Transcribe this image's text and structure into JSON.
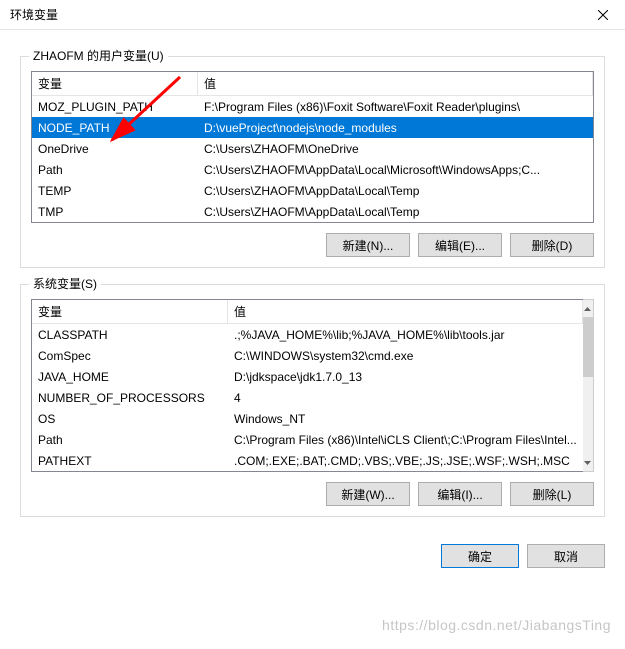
{
  "window": {
    "title": "环境变量"
  },
  "user_vars": {
    "legend": "ZHAOFM 的用户变量(U)",
    "header": {
      "name": "变量",
      "value": "值"
    },
    "rows": [
      {
        "name": "MOZ_PLUGIN_PATH",
        "value": "F:\\Program Files (x86)\\Foxit Software\\Foxit Reader\\plugins\\",
        "selected": false
      },
      {
        "name": "NODE_PATH",
        "value": "D:\\vueProject\\nodejs\\node_modules",
        "selected": true
      },
      {
        "name": "OneDrive",
        "value": "C:\\Users\\ZHAOFM\\OneDrive",
        "selected": false
      },
      {
        "name": "Path",
        "value": "C:\\Users\\ZHAOFM\\AppData\\Local\\Microsoft\\WindowsApps;C...",
        "selected": false
      },
      {
        "name": "TEMP",
        "value": "C:\\Users\\ZHAOFM\\AppData\\Local\\Temp",
        "selected": false
      },
      {
        "name": "TMP",
        "value": "C:\\Users\\ZHAOFM\\AppData\\Local\\Temp",
        "selected": false
      }
    ],
    "buttons": {
      "new": "新建(N)...",
      "edit": "编辑(E)...",
      "delete": "删除(D)"
    }
  },
  "sys_vars": {
    "legend": "系统变量(S)",
    "header": {
      "name": "变量",
      "value": "值"
    },
    "rows": [
      {
        "name": "CLASSPATH",
        "value": ".;%JAVA_HOME%\\lib;%JAVA_HOME%\\lib\\tools.jar"
      },
      {
        "name": "ComSpec",
        "value": "C:\\WINDOWS\\system32\\cmd.exe"
      },
      {
        "name": "JAVA_HOME",
        "value": "D:\\jdkspace\\jdk1.7.0_13"
      },
      {
        "name": "NUMBER_OF_PROCESSORS",
        "value": "4"
      },
      {
        "name": "OS",
        "value": "Windows_NT"
      },
      {
        "name": "Path",
        "value": "C:\\Program Files (x86)\\Intel\\iCLS Client\\;C:\\Program Files\\Intel..."
      },
      {
        "name": "PATHEXT",
        "value": ".COM;.EXE;.BAT;.CMD;.VBS;.VBE;.JS;.JSE;.WSF;.WSH;.MSC"
      }
    ],
    "buttons": {
      "new": "新建(W)...",
      "edit": "编辑(I)...",
      "delete": "删除(L)"
    }
  },
  "dialog_buttons": {
    "ok": "确定",
    "cancel": "取消"
  },
  "annotation": {
    "arrow_color": "#ff0000"
  },
  "watermark": "https://blog.csdn.net/JiabangsTing"
}
